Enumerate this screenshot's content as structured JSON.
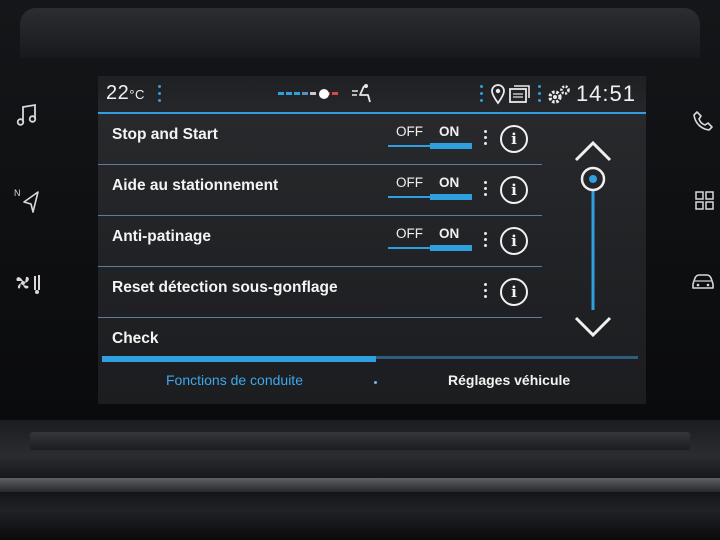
{
  "status_bar": {
    "temperature": "22",
    "temperature_unit": "°C",
    "clock": "14:51",
    "icons": [
      "fan-level-icon",
      "airflow-seat-icon",
      "location-pin-icon",
      "cards-icon",
      "settings-gears-icon"
    ]
  },
  "settings_rows": [
    {
      "label": "Stop and Start",
      "has_toggle": true,
      "off_label": "OFF",
      "on_label": "ON",
      "state": "ON"
    },
    {
      "label": "Aide au stationnement",
      "has_toggle": true,
      "off_label": "OFF",
      "on_label": "ON",
      "state": "ON"
    },
    {
      "label": "Anti-patinage",
      "has_toggle": true,
      "off_label": "OFF",
      "on_label": "ON",
      "state": "ON"
    },
    {
      "label": "Reset détection sous-gonflage",
      "has_toggle": false
    },
    {
      "label": "Check",
      "has_toggle": false
    }
  ],
  "info_glyph": "i",
  "tabs": [
    {
      "label": "Fonctions de conduite",
      "active": true
    },
    {
      "label": "Réglages véhicule",
      "active": false
    }
  ],
  "scroll": {
    "position_fraction": 0.0
  },
  "side_keys_left": [
    "music-note-icon",
    "navigation-icon",
    "climate-fan-icon"
  ],
  "side_keys_right": [
    "phone-icon",
    "apps-grid-icon",
    "car-icon"
  ],
  "colors": {
    "accent": "#2f9fdf",
    "active_tab": "#3ea8ec",
    "text": "#f4f4f4"
  }
}
